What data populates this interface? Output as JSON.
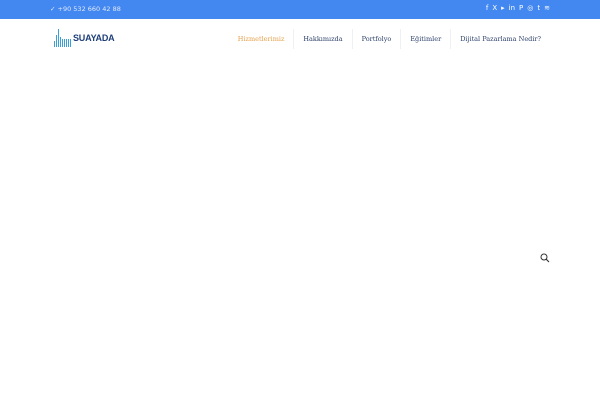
{
  "topbar": {
    "phone": "✓ +90 532 660 42 88",
    "social": [
      "f",
      "X",
      "▸",
      "in",
      "P",
      "◎",
      "t",
      "ॐ"
    ]
  },
  "logo": {
    "text": "SUAYADA"
  },
  "nav": {
    "items": [
      "Hizmetlerimiz",
      "Hakkımızda",
      "Portfolyo",
      "Eğitimler",
      "Dijital Pazarlama Nedir?"
    ]
  }
}
